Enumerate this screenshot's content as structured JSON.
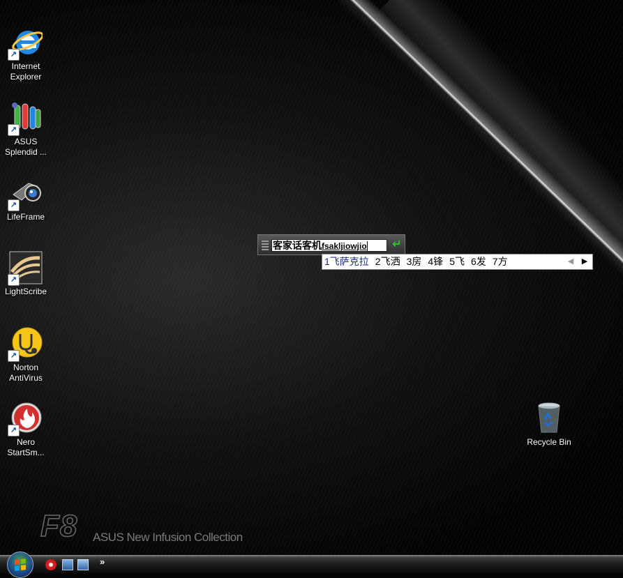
{
  "desktop": {
    "brand_model": "F8",
    "brand_tagline": "ASUS New Infusion Collection",
    "icons": [
      {
        "label_line1": "Internet",
        "label_line2": "Explorer",
        "icon": "internet-explorer-icon"
      },
      {
        "label_line1": "ASUS",
        "label_line2": "Splendid ...",
        "icon": "asus-splendid-icon"
      },
      {
        "label_line1": "LifeFrame",
        "label_line2": "",
        "icon": "lifeframe-icon"
      },
      {
        "label_line1": "LightScribe",
        "label_line2": "",
        "icon": "lightscribe-icon"
      },
      {
        "label_line1": "Norton",
        "label_line2": "AntiVirus",
        "icon": "norton-antivirus-icon"
      },
      {
        "label_line1": "Nero",
        "label_line2": "StartSm...",
        "icon": "nero-startsmart-icon"
      }
    ],
    "recycle_bin": {
      "label": "Recycle Bin",
      "icon": "recycle-bin-icon"
    }
  },
  "ime": {
    "composition_text": "客家话客机",
    "pinyin_text": "fsakljiowjio",
    "candidates": [
      "1飞萨克拉",
      "2飞洒",
      "3房",
      "4锋",
      "5飞",
      "6发",
      "7方"
    ],
    "prev_arrow": "◀",
    "next_arrow": "▶",
    "enter_glyph": "↵"
  },
  "taskbar": {
    "start_icon": "windows-start-orb",
    "quick_launch": [
      "nero-icon",
      "show-desktop-icon",
      "switch-windows-icon"
    ],
    "more_label": "»"
  }
}
